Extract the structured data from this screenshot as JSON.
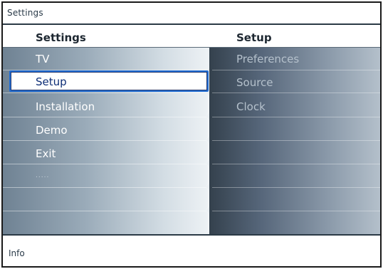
{
  "window": {
    "title": "Settings"
  },
  "header": {
    "left_title": "Settings",
    "right_title": "Setup"
  },
  "menu": {
    "items": [
      {
        "label": "TV",
        "selected": false
      },
      {
        "label": "Setup",
        "selected": true
      },
      {
        "label": "Installation",
        "selected": false
      },
      {
        "label": "Demo",
        "selected": false
      },
      {
        "label": "Exit",
        "selected": false
      },
      {
        "label": ".....",
        "selected": false
      }
    ]
  },
  "submenu": {
    "items": [
      {
        "label": "Preferences"
      },
      {
        "label": "Source"
      },
      {
        "label": "Clock"
      }
    ]
  },
  "footer": {
    "info": "Info"
  },
  "colors": {
    "selection_border": "#1f6bd2",
    "selection_text": "#0c2d76",
    "frame": "#1a1a1a"
  }
}
